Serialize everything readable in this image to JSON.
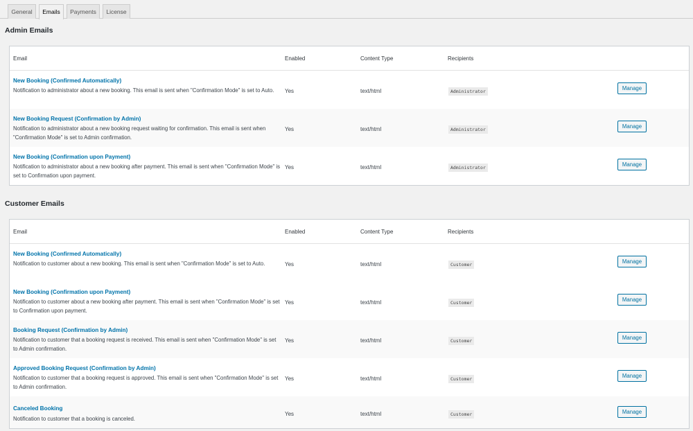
{
  "tabs": [
    "General",
    "Emails",
    "Payments",
    "License"
  ],
  "admin": {
    "title": "Admin Emails",
    "headers": {
      "email": "Email",
      "enabled": "Enabled",
      "content_type": "Content Type",
      "recipients": "Recipients"
    },
    "rows": [
      {
        "title": "New Booking (Confirmed Automatically)",
        "desc": "Notification to administrator about a new booking. This email is sent when \"Confirmation Mode\" is set to Auto.",
        "enabled": "Yes",
        "content_type": "text/html",
        "recipients": "Administrator",
        "button": "Manage"
      },
      {
        "title": "New Booking Request (Confirmation by Admin)",
        "desc": "Notification to administrator about a new booking request waiting for confirmation. This email is sent when \"Confirmation Mode\" is set to Admin confirmation.",
        "enabled": "Yes",
        "content_type": "text/html",
        "recipients": "Administrator",
        "button": "Manage"
      },
      {
        "title": "New Booking (Confirmation upon Payment)",
        "desc": "Notification to administrator about a new booking after payment. This email is sent when \"Confirmation Mode\" is set to Confirmation upon payment.",
        "enabled": "Yes",
        "content_type": "text/html",
        "recipients": "Administrator",
        "button": "Manage"
      }
    ]
  },
  "customer": {
    "title": "Customer Emails",
    "headers": {
      "email": "Email",
      "enabled": "Enabled",
      "content_type": "Content Type",
      "recipients": "Recipients"
    },
    "rows": [
      {
        "title": "New Booking (Confirmed Automatically)",
        "desc": "Notification to customer about a new booking. This email is sent when \"Confirmation Mode\" is set to Auto.",
        "enabled": "Yes",
        "content_type": "text/html",
        "recipients": "Customer",
        "button": "Manage"
      },
      {
        "title": "New Booking (Confirmation upon Payment)",
        "desc": "Notification to customer about a new booking after payment. This email is sent when \"Confirmation Mode\" is set to Confirmation upon payment.",
        "enabled": "Yes",
        "content_type": "text/html",
        "recipients": "Customer",
        "button": "Manage"
      },
      {
        "title": "Booking Request (Confirmation by Admin)",
        "desc": "Notification to customer that a booking request is received. This email is sent when \"Confirmation Mode\" is set to Admin confirmation.",
        "enabled": "Yes",
        "content_type": "text/html",
        "recipients": "Customer",
        "button": "Manage"
      },
      {
        "title": "Approved Booking Request (Confirmation by Admin)",
        "desc": "Notification to customer that a booking request is approved. This email is sent when \"Confirmation Mode\" is set to Admin confirmation.",
        "enabled": "Yes",
        "content_type": "text/html",
        "recipients": "Customer",
        "button": "Manage"
      },
      {
        "title": "Canceled Booking",
        "desc": "Notification to customer that a booking is canceled.",
        "enabled": "Yes",
        "content_type": "text/html",
        "recipients": "Customer",
        "button": "Manage"
      }
    ]
  }
}
